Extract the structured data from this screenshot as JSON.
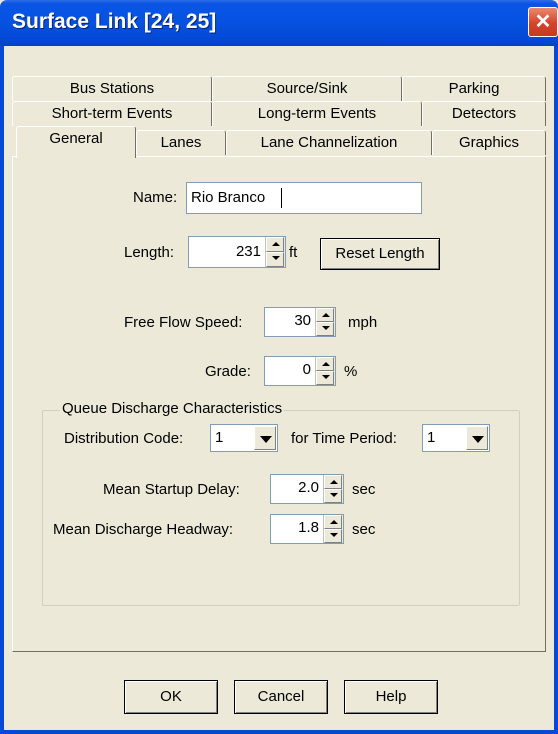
{
  "window": {
    "title": "Surface Link [24, 25]",
    "close_glyph": "✕"
  },
  "tabs": {
    "row1": [
      "Bus Stations",
      "Source/Sink",
      "Parking"
    ],
    "row2": [
      "Short-term Events",
      "Long-term Events",
      "Detectors"
    ],
    "row3": [
      "General",
      "Lanes",
      "Lane Channelization",
      "Graphics"
    ],
    "active": "General"
  },
  "general": {
    "name_label": "Name:",
    "name_value": "Rio Branco",
    "length_label": "Length:",
    "length_value": "231",
    "length_unit": "ft",
    "reset_length_label": "Reset Length",
    "free_flow_label": "Free Flow Speed:",
    "free_flow_value": "30",
    "free_flow_unit": "mph",
    "grade_label": "Grade:",
    "grade_value": "0",
    "grade_unit": "%"
  },
  "queue": {
    "group_label": "Queue Discharge Characteristics",
    "distribution_label": "Distribution Code:",
    "distribution_value": "1",
    "time_period_label": "for Time Period:",
    "time_period_value": "1",
    "startup_label": "Mean Startup Delay:",
    "startup_value": "2.0",
    "startup_unit": "sec",
    "headway_label": "Mean Discharge Headway:",
    "headway_value": "1.8",
    "headway_unit": "sec"
  },
  "buttons": {
    "ok": "OK",
    "cancel": "Cancel",
    "help": "Help"
  },
  "colors": {
    "titlebar": "#0549d6",
    "dialog_bg": "#ece9d8",
    "close": "#d5432a"
  }
}
